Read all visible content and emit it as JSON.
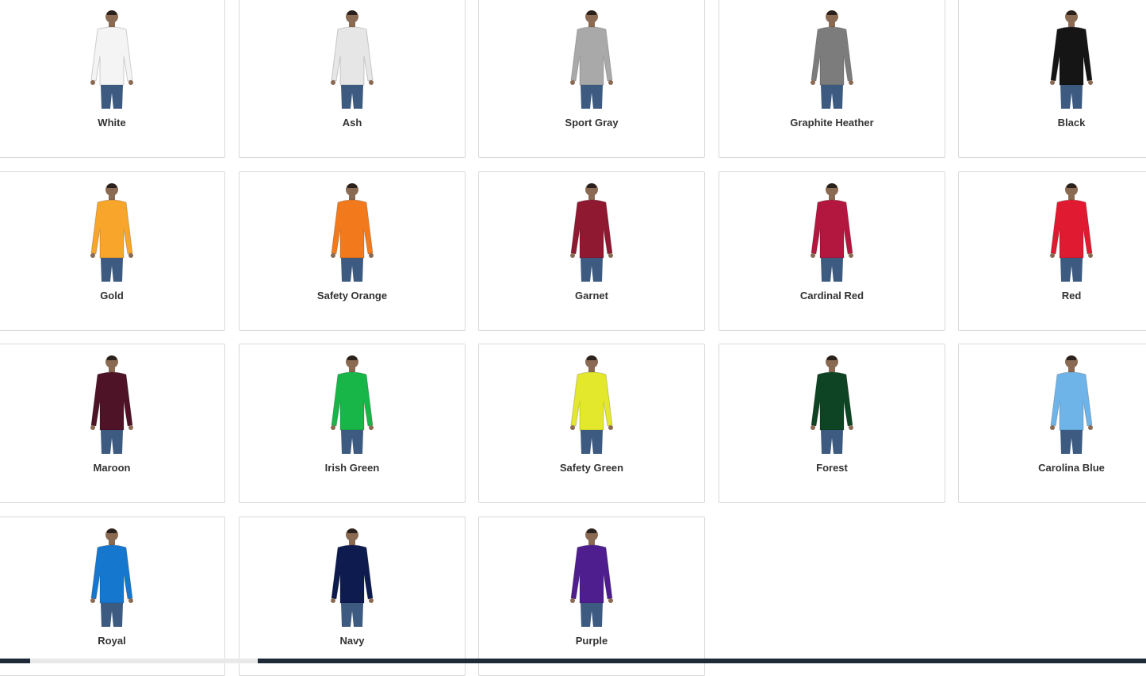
{
  "colors": [
    {
      "name": "White",
      "hex": "#f4f4f4"
    },
    {
      "name": "Ash",
      "hex": "#e6e6e6"
    },
    {
      "name": "Sport Gray",
      "hex": "#a9a9a9"
    },
    {
      "name": "Graphite Heather",
      "hex": "#7c7c7c"
    },
    {
      "name": "Black",
      "hex": "#151515"
    },
    {
      "name": "Gold",
      "hex": "#f7a52b"
    },
    {
      "name": "Safety Orange",
      "hex": "#f27a1c"
    },
    {
      "name": "Garnet",
      "hex": "#8e1931"
    },
    {
      "name": "Cardinal Red",
      "hex": "#b3173f"
    },
    {
      "name": "Red",
      "hex": "#e01a30"
    },
    {
      "name": "Maroon",
      "hex": "#4e1326"
    },
    {
      "name": "Irish Green",
      "hex": "#18b548"
    },
    {
      "name": "Safety Green",
      "hex": "#e4e82c"
    },
    {
      "name": "Forest",
      "hex": "#0e4423"
    },
    {
      "name": "Carolina Blue",
      "hex": "#6fb4e8"
    },
    {
      "name": "Royal",
      "hex": "#1677cf"
    },
    {
      "name": "Navy",
      "hex": "#0d1b4f"
    },
    {
      "name": "Purple",
      "hex": "#4e1e8e"
    }
  ]
}
